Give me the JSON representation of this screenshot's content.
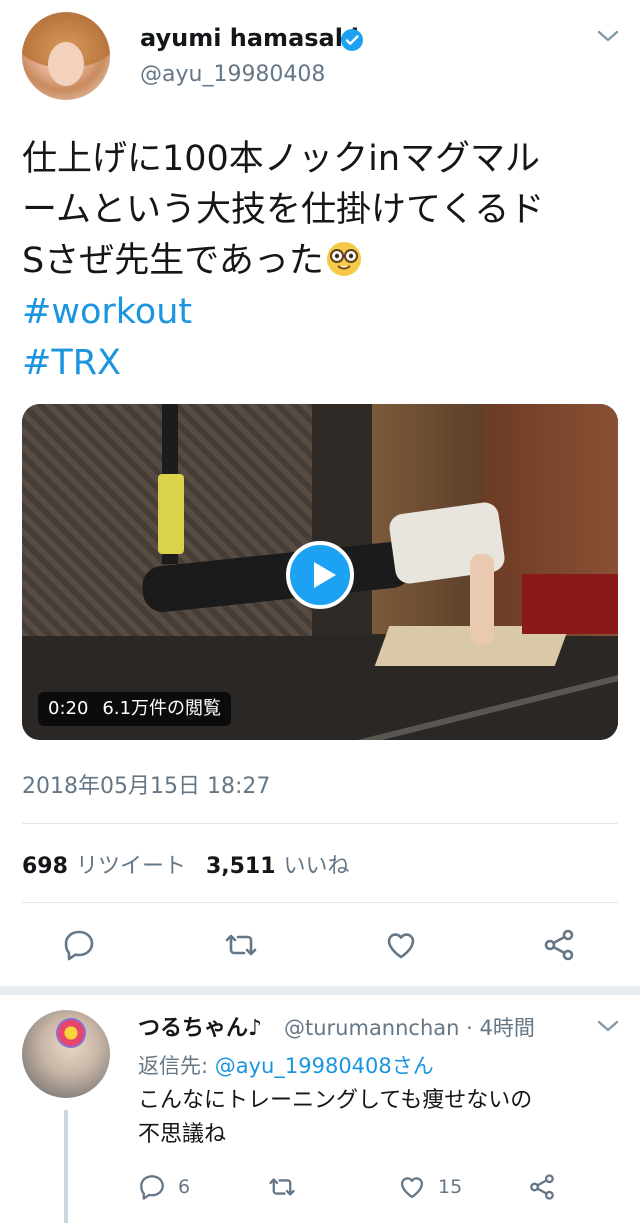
{
  "tweet": {
    "author_name": "ayumi hamasaki",
    "author_handle": "@ayu_19980408",
    "text_lines": [
      "仕上げに100本ノックinマグマル",
      "ームという大技を仕掛けてくるド",
      "Sさぜ先生であった"
    ],
    "emoji": "nerd-face-emoji",
    "hashtags": [
      "#workout",
      "#TRX"
    ],
    "video": {
      "duration": "0:20",
      "views": "6.1万件の閲覧"
    },
    "timestamp": "2018年05月15日 18:27",
    "stats": {
      "retweets_count": "698",
      "retweets_label": "リツイート",
      "likes_count": "3,511",
      "likes_label": "いいね"
    },
    "actions": [
      "reply-icon",
      "retweet-icon",
      "like-icon",
      "share-icon"
    ]
  },
  "reply": {
    "author_name": "つるちゃん♪",
    "author_handle": "@turumannchan · 4時間",
    "reply_to_prefix": "返信先:",
    "reply_to_link": "@ayu_19980408さん",
    "text_lines": [
      "こんなにトレーニングしても痩せないの",
      "不思議ね"
    ],
    "reply_count": "6",
    "like_count": "15"
  },
  "colors": {
    "link": "#1b95e0",
    "verified": "#1da1f2",
    "secondary_text": "#657786",
    "divider": "#e1e8ed"
  }
}
